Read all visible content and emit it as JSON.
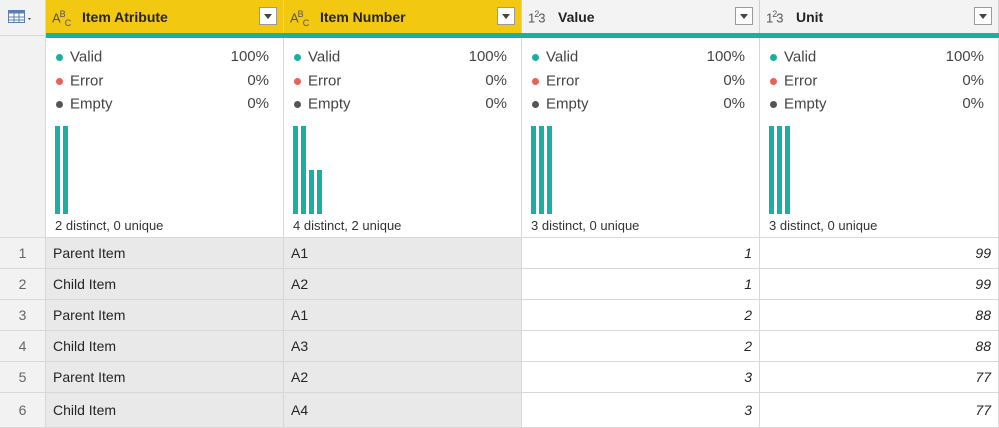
{
  "columns": [
    {
      "type_icon": "ABC",
      "title": "Item Atribute",
      "selected": true,
      "valid_label": "Valid",
      "valid_pct": "100%",
      "error_label": "Error",
      "error_pct": "0%",
      "empty_label": "Empty",
      "empty_pct": "0%",
      "distribution": [
        1,
        1
      ],
      "footer": "2 distinct, 0 unique"
    },
    {
      "type_icon": "ABC",
      "title": "Item Number",
      "selected": true,
      "valid_label": "Valid",
      "valid_pct": "100%",
      "error_label": "Error",
      "error_pct": "0%",
      "empty_label": "Empty",
      "empty_pct": "0%",
      "distribution": [
        1,
        1,
        0.5,
        0.5
      ],
      "footer": "4 distinct, 2 unique"
    },
    {
      "type_icon": "123",
      "title": "Value",
      "selected": false,
      "valid_label": "Valid",
      "valid_pct": "100%",
      "error_label": "Error",
      "error_pct": "0%",
      "empty_label": "Empty",
      "empty_pct": "0%",
      "distribution": [
        1,
        1,
        1
      ],
      "footer": "3 distinct, 0 unique"
    },
    {
      "type_icon": "123",
      "title": "Unit",
      "selected": false,
      "valid_label": "Valid",
      "valid_pct": "100%",
      "error_label": "Error",
      "error_pct": "0%",
      "empty_label": "Empty",
      "empty_pct": "0%",
      "distribution": [
        1,
        1,
        1
      ],
      "footer": "3 distinct, 0 unique"
    }
  ],
  "rows": [
    {
      "num": "1",
      "attr": "Parent Item",
      "item": "A1",
      "value": "1",
      "unit": "99"
    },
    {
      "num": "2",
      "attr": "Child Item",
      "item": "A2",
      "value": "1",
      "unit": "99"
    },
    {
      "num": "3",
      "attr": "Parent Item",
      "item": "A1",
      "value": "2",
      "unit": "88"
    },
    {
      "num": "4",
      "attr": "Child Item",
      "item": "A3",
      "value": "2",
      "unit": "88"
    },
    {
      "num": "5",
      "attr": "Parent Item",
      "item": "A2",
      "value": "3",
      "unit": "77"
    },
    {
      "num": "6",
      "attr": "Child Item",
      "item": "A4",
      "value": "3",
      "unit": "77"
    }
  ],
  "colors": {
    "accent": "#1aaf9e",
    "selected_header": "#f2c811",
    "valid": "#1aaf9e",
    "error": "#e8605a",
    "empty": "#555555"
  }
}
